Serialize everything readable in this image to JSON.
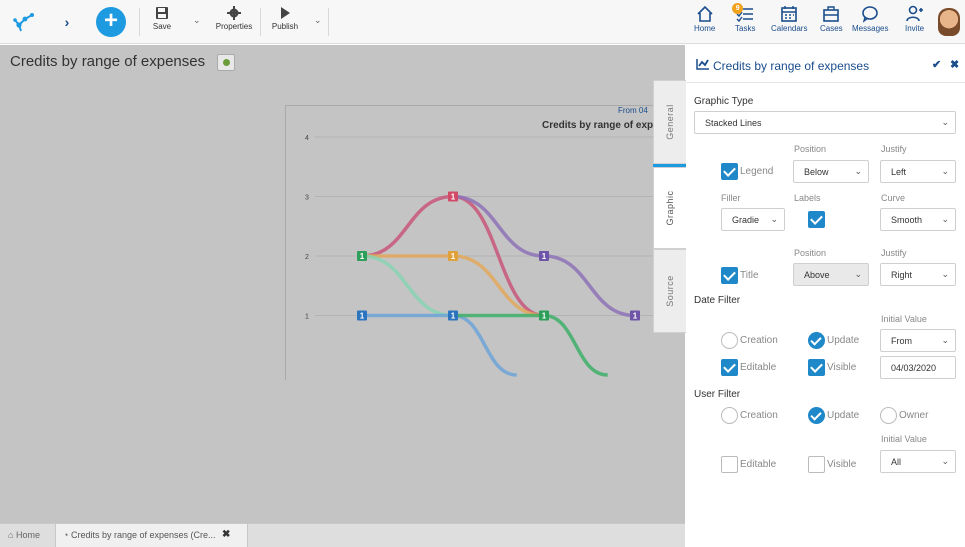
{
  "toolbar": {
    "save_label": "Save",
    "properties_label": "Properties",
    "publish_label": "Publish"
  },
  "top_nav": {
    "home": "Home",
    "tasks": "Tasks",
    "tasks_badge": "9",
    "calendars": "Calendars",
    "cases": "Cases",
    "messages": "Messages",
    "invite": "Invite"
  },
  "main": {
    "title": "Credits by range of expenses"
  },
  "side_tabs": {
    "general": "General",
    "graphic": "Graphic",
    "source": "Source"
  },
  "bottom_tabs": {
    "home": "Home",
    "active_tab": "Credits by range of expenses (Cre..."
  },
  "panel": {
    "title": "Credits by range of expenses",
    "graphic_type_label": "Graphic Type",
    "graphic_type_value": "Stacked Lines",
    "legend": {
      "label": "Legend",
      "position_label": "Position",
      "position_value": "Below",
      "justify_label": "Justify",
      "justify_value": "Left",
      "checked": true
    },
    "filler": {
      "label": "Filler",
      "value": "Gradie"
    },
    "labels": {
      "label": "Labels",
      "checked": true
    },
    "curve": {
      "label": "Curve",
      "value": "Smooth"
    },
    "title_opt": {
      "label": "Title",
      "position_label": "Position",
      "position_value": "Above",
      "justify_label": "Justify",
      "justify_value": "Right",
      "checked": true
    },
    "date_filter": {
      "label": "Date Filter",
      "creation": "Creation",
      "update": "Update",
      "initial_value_label": "Initial Value",
      "initial_value": "From",
      "editable": "Editable",
      "visible": "Visible",
      "date": "04/03/2020"
    },
    "user_filter": {
      "label": "User Filter",
      "creation": "Creation",
      "update": "Update",
      "owner": "Owner",
      "initial_value_label": "Initial Value",
      "initial_value": "All",
      "editable": "Editable",
      "visible": "Visible"
    }
  },
  "chart_data": {
    "type": "line",
    "title": "Credits by range of exp",
    "subtitle": "From 04",
    "y_ticks": [
      "1",
      "2",
      "3",
      "4"
    ],
    "ylim": [
      0,
      4
    ],
    "grid": true,
    "series": [
      {
        "color": "#c9577a",
        "points": [
          [
            0,
            2
          ],
          [
            1,
            3
          ],
          [
            2,
            1
          ]
        ]
      },
      {
        "color": "#8e73b7",
        "points": [
          [
            1,
            3
          ],
          [
            2,
            2
          ],
          [
            3,
            1
          ]
        ]
      },
      {
        "color": "#e3a95c",
        "points": [
          [
            0,
            2
          ],
          [
            1,
            2
          ],
          [
            2,
            1
          ]
        ]
      },
      {
        "color": "#88d4b4",
        "points": [
          [
            0,
            2
          ],
          [
            1,
            1
          ]
        ]
      },
      {
        "color": "#6fa5d8",
        "points": [
          [
            0,
            1
          ],
          [
            1,
            1
          ],
          [
            1.7,
            0
          ]
        ]
      },
      {
        "color": "#3fb06a",
        "points": [
          [
            1,
            1
          ],
          [
            2,
            1
          ],
          [
            2.7,
            0
          ]
        ]
      }
    ],
    "markers": [
      {
        "x": 0,
        "y": 2,
        "label": "1",
        "color": "#2e9e5b"
      },
      {
        "x": 0,
        "y": 1,
        "label": "1",
        "color": "#2d74bf"
      },
      {
        "x": 1,
        "y": 3,
        "label": "1",
        "color": "#d14b68"
      },
      {
        "x": 1,
        "y": 2,
        "label": "1",
        "color": "#e0a13b"
      },
      {
        "x": 1,
        "y": 1,
        "label": "1",
        "color": "#2d74bf"
      },
      {
        "x": 2,
        "y": 2,
        "label": "1",
        "color": "#6e55a8"
      },
      {
        "x": 2,
        "y": 1,
        "label": "1",
        "color": "#2e9e5b"
      },
      {
        "x": 3,
        "y": 1,
        "label": "1",
        "color": "#6e55a8"
      }
    ]
  }
}
